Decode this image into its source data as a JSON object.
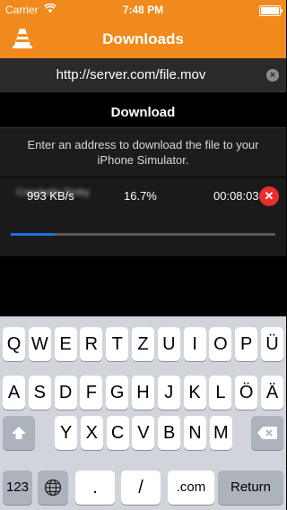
{
  "status_bar": {
    "carrier": "Carrier",
    "time": "7:48 PM"
  },
  "nav": {
    "title": "Downloads"
  },
  "url_input": {
    "value": "http://server.com/file.mov"
  },
  "download_button": {
    "label": "Download"
  },
  "help_text": "Enter an address to download the file to your iPhone Simulator.",
  "download_item": {
    "name": "Coachella Zimby",
    "speed": "993 KB/s",
    "percent": "16.7%",
    "remaining": "00:08:03",
    "progress": 0.167
  },
  "keyboard": {
    "row1": [
      "Q",
      "W",
      "E",
      "R",
      "T",
      "Z",
      "U",
      "I",
      "O",
      "P",
      "Ü"
    ],
    "row2": [
      "A",
      "S",
      "D",
      "F",
      "G",
      "H",
      "J",
      "K",
      "L",
      "Ö",
      "Ä"
    ],
    "row3": [
      "Y",
      "X",
      "C",
      "V",
      "B",
      "N",
      "M"
    ],
    "bottom": {
      "numbers": "123",
      "dot": ".",
      "slash": "/",
      "dotcom": ".com",
      "return": "Return"
    }
  }
}
